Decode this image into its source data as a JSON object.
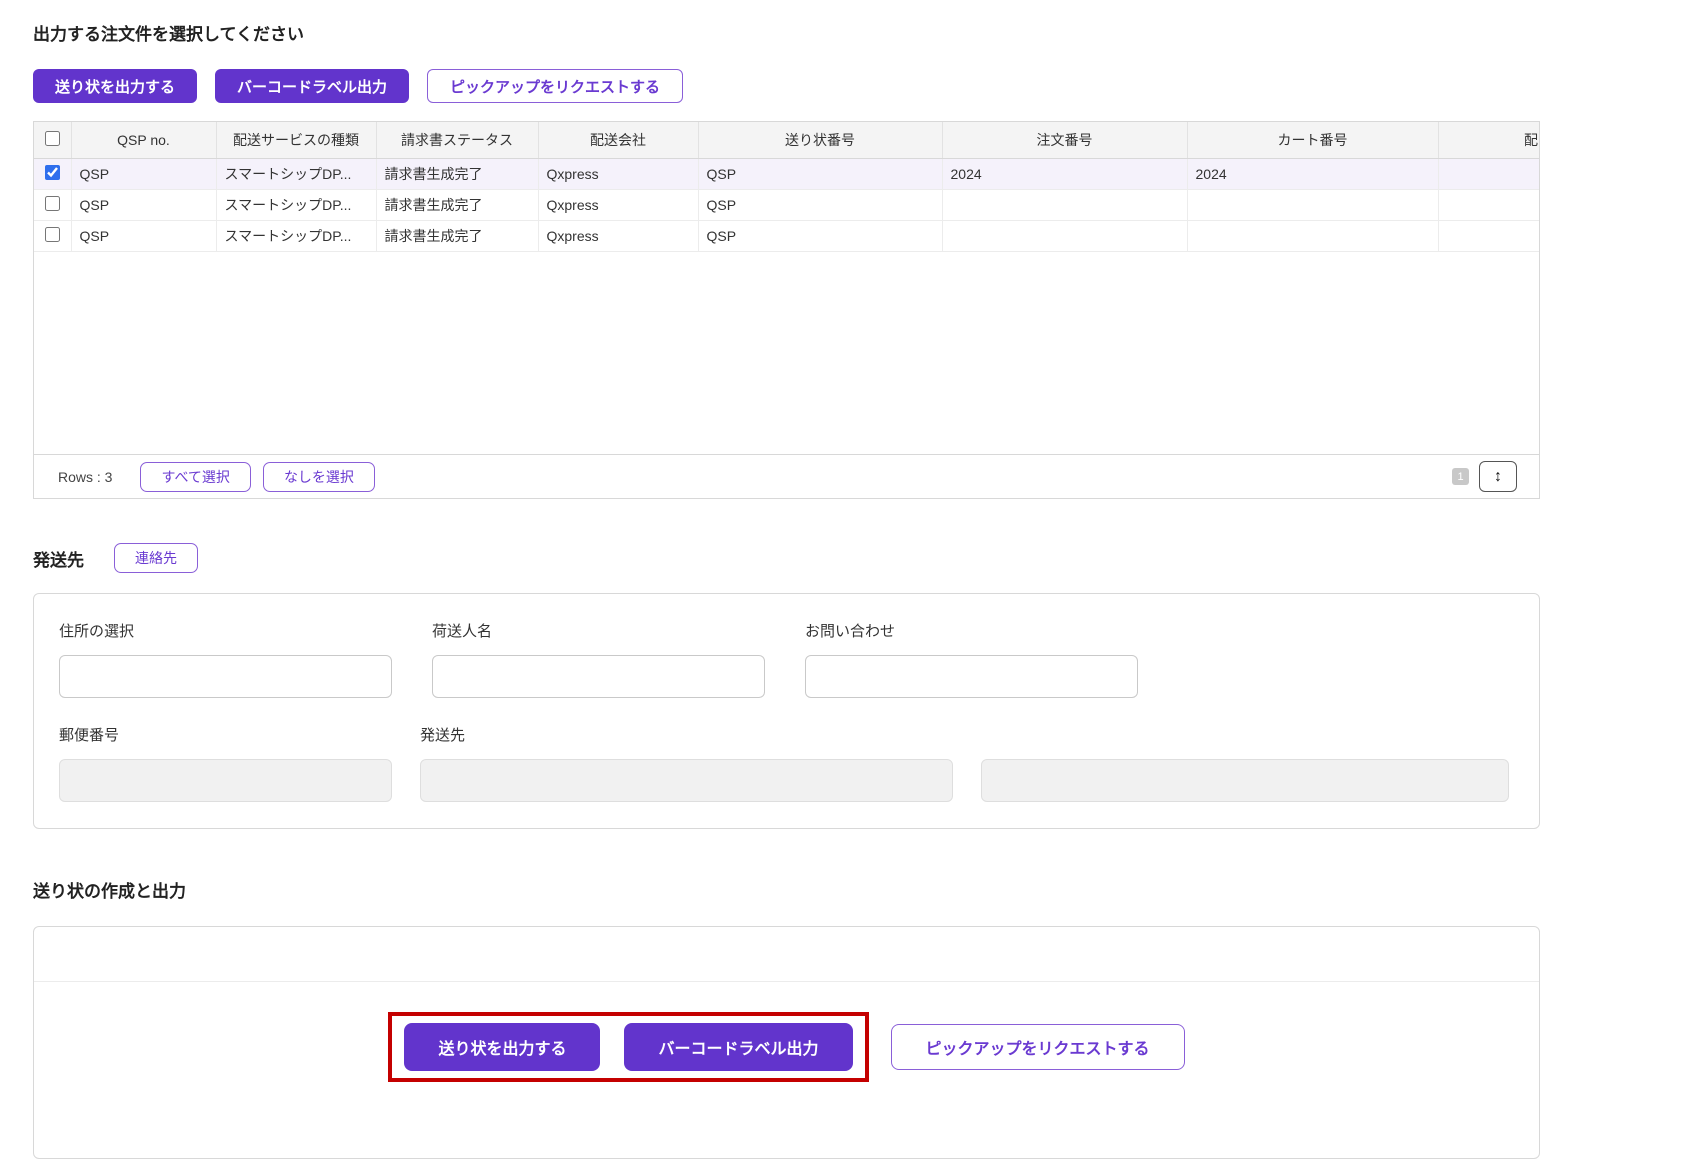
{
  "colors": {
    "accent": "#6234cc",
    "highlight_red": "#c40000",
    "selected_row": "#f5f2fb"
  },
  "page_title": "出力する注文件を選択してください",
  "toolbar": {
    "print_invoice": "送り状を出力する",
    "barcode_label": "バーコードラベル出力",
    "request_pickup": "ピックアップをリクエストする"
  },
  "table": {
    "columns": [
      "QSP no.",
      "配送サービスの種類",
      "請求書ステータス",
      "配送会社",
      "送り状番号",
      "注文番号",
      "カート番号",
      "配"
    ],
    "rows": [
      {
        "checked_attr": "checked",
        "qsp_no": "QSP",
        "service_type": "スマートシップDP...",
        "invoice_status": "請求書生成完了",
        "carrier": "Qxpress",
        "tracking_no": "QSP",
        "order_no": "2024",
        "cart_no": "2024",
        "extra": ""
      },
      {
        "qsp_no": "QSP",
        "service_type": "スマートシップDP...",
        "invoice_status": "請求書生成完了",
        "carrier": "Qxpress",
        "tracking_no": "QSP",
        "order_no": "",
        "cart_no": "",
        "extra": ""
      },
      {
        "qsp_no": "QSP",
        "service_type": "スマートシップDP...",
        "invoice_status": "請求書生成完了",
        "carrier": "Qxpress",
        "tracking_no": "QSP",
        "order_no": "",
        "cart_no": "",
        "extra": ""
      }
    ],
    "footer": {
      "rows_label": "Rows : 3",
      "select_all": "すべて選択",
      "select_none": "なしを選択",
      "page_number": "1",
      "resize_icon": "↕"
    }
  },
  "shipper": {
    "heading": "発送先",
    "contact_button": "連絡先",
    "labels": {
      "address_select": "住所の選択",
      "shipper_name": "荷送人名",
      "inquiry": "お問い合わせ",
      "postal_code": "郵便番号",
      "ship_from": "発送先"
    }
  },
  "output_section": {
    "heading": "送り状の作成と出力",
    "print_invoice": "送り状を出力する",
    "barcode_label": "バーコードラベル出力",
    "request_pickup": "ピックアップをリクエストする"
  }
}
